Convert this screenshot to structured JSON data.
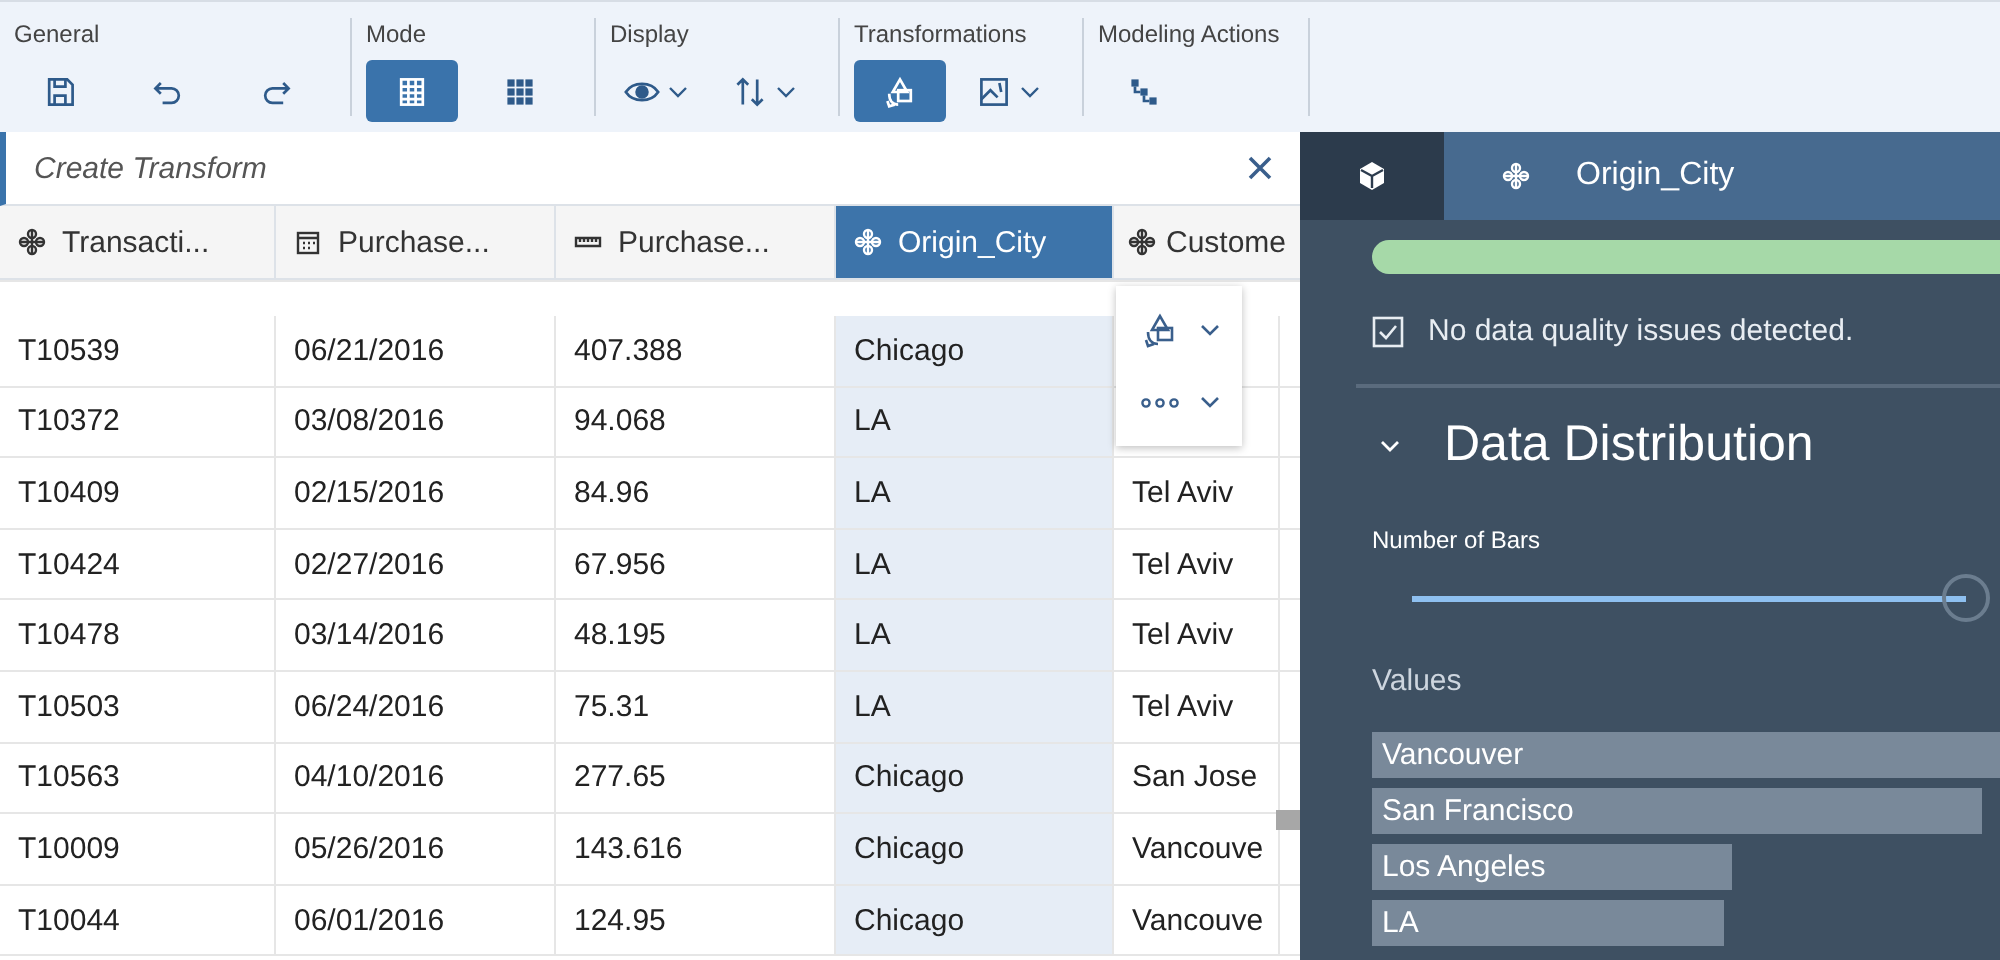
{
  "toolbar": {
    "groups": [
      {
        "label": "General",
        "buttons": [
          {
            "kind": "save",
            "selected": false,
            "dropdown": false
          },
          {
            "kind": "undo",
            "selected": false,
            "dropdown": false
          },
          {
            "kind": "redo",
            "selected": false,
            "dropdown": false
          }
        ]
      },
      {
        "label": "Mode",
        "buttons": [
          {
            "kind": "table",
            "selected": true,
            "dropdown": false
          },
          {
            "kind": "grid",
            "selected": false,
            "dropdown": false
          }
        ]
      },
      {
        "label": "Display",
        "buttons": [
          {
            "kind": "eye",
            "selected": false,
            "dropdown": true
          },
          {
            "kind": "sort",
            "selected": false,
            "dropdown": true
          }
        ]
      },
      {
        "label": "Transformations",
        "buttons": [
          {
            "kind": "transform",
            "selected": true,
            "dropdown": false
          },
          {
            "kind": "image",
            "selected": false,
            "dropdown": true
          }
        ]
      },
      {
        "label": "Modeling Actions",
        "buttons": [
          {
            "kind": "hierarchy",
            "selected": false,
            "dropdown": false
          }
        ]
      }
    ]
  },
  "transform_field": {
    "placeholder": "Create Transform"
  },
  "table": {
    "columns": [
      {
        "label": "Transacti...",
        "kind": "dimension",
        "selected": false
      },
      {
        "label": "Purchase...",
        "kind": "date",
        "selected": false
      },
      {
        "label": "Purchase...",
        "kind": "measure",
        "selected": false
      },
      {
        "label": "Origin_City",
        "kind": "dimension",
        "selected": true
      },
      {
        "label": "Custome",
        "kind": "dimension",
        "selected": false
      }
    ],
    "rows": [
      [
        "T10539",
        "06/21/2016",
        "407.388",
        "Chicago"
      ],
      [
        "T10372",
        "03/08/2016",
        "94.068",
        "LA"
      ],
      [
        "T10409",
        "02/15/2016",
        "84.96",
        "LA",
        "Tel Aviv"
      ],
      [
        "T10424",
        "02/27/2016",
        "67.956",
        "LA",
        "Tel Aviv"
      ],
      [
        "T10478",
        "03/14/2016",
        "48.195",
        "LA",
        "Tel Aviv"
      ],
      [
        "T10503",
        "06/24/2016",
        "75.31",
        "LA",
        "Tel Aviv"
      ],
      [
        "T10563",
        "04/10/2016",
        "277.65",
        "Chicago",
        "San Jose"
      ],
      [
        "T10009",
        "05/26/2016",
        "143.616",
        "Chicago",
        "Vancouve"
      ],
      [
        "T10044",
        "06/01/2016",
        "124.95",
        "Chicago",
        "Vancouve"
      ]
    ]
  },
  "column_menu": {
    "items": [
      {
        "kind": "transform"
      },
      {
        "kind": "more"
      }
    ]
  },
  "panel": {
    "tabs": [
      {
        "kind": "cube",
        "selected": false
      },
      {
        "kind": "dimension",
        "label": "Origin_City",
        "selected": true
      }
    ],
    "quality": {
      "level": 1,
      "checked": true,
      "message": "No data quality issues detected."
    },
    "section": {
      "title": "Data Distribution",
      "expanded": true
    },
    "slider": {
      "label": "Number of Bars",
      "level": 0.95
    },
    "values_label": "Values",
    "bars": [
      "Vancouver",
      "San Francisco",
      "Los Angeles",
      "LA"
    ]
  }
}
